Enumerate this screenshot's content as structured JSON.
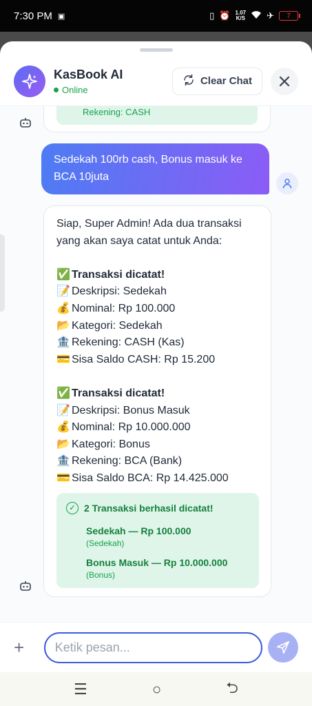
{
  "status": {
    "time": "7:30 PM",
    "speed": "1.07",
    "speed_unit": "K/S",
    "battery": "7"
  },
  "header": {
    "title": "KasBook AI",
    "status": "Online",
    "clear_label": "Clear Chat"
  },
  "previous": {
    "text": "Rekening: CASH"
  },
  "user_message": "Sedekah 100rb cash, Bonus masuk ke BCA 10juta",
  "bot": {
    "intro1": "Siap, Super Admin! Ada dua transaksi",
    "intro2": "yang akan saya catat untuk Anda:",
    "tx1": {
      "title": "Transaksi dicatat!",
      "desc": "Deskripsi: Sedekah",
      "amount": "Nominal: Rp 100.000",
      "category": "Kategori: Sedekah",
      "account": "Rekening: CASH (Kas)",
      "balance": "Sisa Saldo CASH: Rp 15.200"
    },
    "tx2": {
      "title": "Transaksi dicatat!",
      "desc": "Deskripsi: Bonus Masuk",
      "amount": "Nominal: Rp 10.000.000",
      "category": "Kategori: Bonus",
      "account": "Rekening: BCA (Bank)",
      "balance": "Sisa Saldo BCA: Rp 14.425.000"
    },
    "summary": {
      "title": "2 Transaksi berhasil dicatat!",
      "items": [
        {
          "name": "Sedekah",
          "amount": "Rp 100.000",
          "sub": "(Sedekah)"
        },
        {
          "name": "Bonus Masuk",
          "amount": "Rp 10.000.000",
          "sub": "(Bonus)"
        }
      ]
    }
  },
  "input": {
    "placeholder": "Ketik pesan..."
  },
  "icons": {
    "logo": "sparkle-icon",
    "clear": "refresh-icon",
    "close": "close-icon",
    "bot": "robot-icon",
    "user": "user-icon",
    "send": "send-icon",
    "add": "plus-icon"
  },
  "colors": {
    "accent": "#4d7cf3",
    "accent2": "#8b5cf6",
    "success": "#16a34a",
    "success_bg": "#dff5ea"
  }
}
